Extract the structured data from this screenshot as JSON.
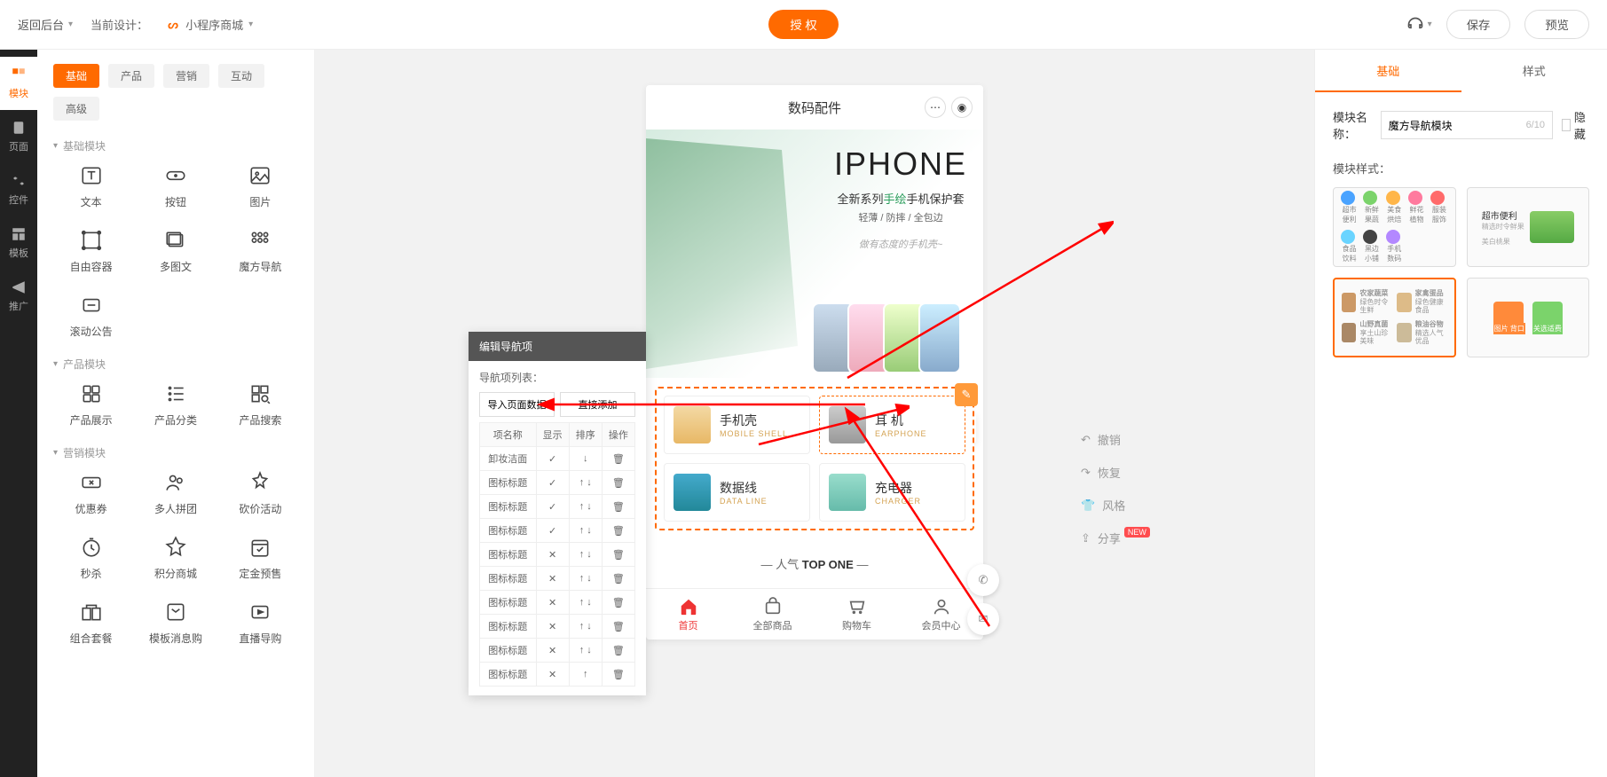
{
  "topbar": {
    "back": "返回后台",
    "cur_design_label": "当前设计：",
    "cur_design_value": "小程序商城",
    "auth": "授 权",
    "save": "保存",
    "preview": "预览"
  },
  "rail": [
    {
      "label": "模块",
      "active": true
    },
    {
      "label": "页面"
    },
    {
      "label": "控件"
    },
    {
      "label": "模板"
    },
    {
      "label": "推广"
    }
  ],
  "module_tabs_row1": [
    "基础",
    "产品",
    "营销",
    "互动"
  ],
  "module_tabs_row2": [
    "高级"
  ],
  "sections": [
    {
      "title": "基础模块",
      "items": [
        "文本",
        "按钮",
        "图片",
        "自由容器",
        "多图文",
        "魔方导航",
        "滚动公告"
      ]
    },
    {
      "title": "产品模块",
      "items": [
        "产品展示",
        "产品分类",
        "产品搜索"
      ]
    },
    {
      "title": "营销模块",
      "items": [
        "优惠券",
        "多人拼团",
        "砍价活动",
        "秒杀",
        "积分商城",
        "定金预售",
        "组合套餐",
        "模板消息购",
        "直播导购"
      ]
    }
  ],
  "navpop": {
    "title": "编辑导航项",
    "list_label": "导航项列表：",
    "import_btn": "导入页面数据",
    "add_btn": "直接添加",
    "cols": [
      "项名称",
      "显示",
      "排序",
      "操作"
    ],
    "rows": [
      {
        "name": "卸妆洁面",
        "show": true,
        "first": true
      },
      {
        "name": "图标标题",
        "show": true
      },
      {
        "name": "图标标题",
        "show": true
      },
      {
        "name": "图标标题",
        "show": true
      },
      {
        "name": "图标标题",
        "show": false
      },
      {
        "name": "图标标题",
        "show": false
      },
      {
        "name": "图标标题",
        "show": false
      },
      {
        "name": "图标标题",
        "show": false
      },
      {
        "name": "图标标题",
        "show": false
      },
      {
        "name": "图标标题",
        "show": false,
        "last": true
      }
    ]
  },
  "phone": {
    "title": "数码配件",
    "hero": {
      "h1": "IPHONE",
      "sub_pre": "全新系列",
      "sub_em": "手绘",
      "sub_post": "手机保护套",
      "sub2": "轻薄 / 防摔 / 全包边",
      "sub3": "做有态度的手机壳~"
    },
    "edit_module": "编辑模块",
    "nav": [
      {
        "cn": "手机壳",
        "en": "MOBILE SHELL"
      },
      {
        "cn": "耳 机",
        "en": "EARPHONE"
      },
      {
        "cn": "数据线",
        "en": "DATA LINE"
      },
      {
        "cn": "充电器",
        "en": "CHARGER"
      }
    ],
    "section_title_pre": "— 人气 ",
    "section_title_strong": "TOP ONE",
    "section_title_post": " —",
    "tabbar": [
      "首页",
      "全部商品",
      "购物车",
      "会员中心"
    ]
  },
  "cv_actions": {
    "undo": "撤销",
    "redo": "恢复",
    "style": "风格",
    "share": "分享",
    "new": "NEW"
  },
  "props": {
    "tab_basic": "基础",
    "tab_style": "样式",
    "name_label": "模块名称：",
    "name_value": "魔方导航模块",
    "char": "6/10",
    "hide": "隐藏",
    "style_label": "模块样式：",
    "style_a_labels": [
      "超市便利",
      "新鲜果蔬",
      "美食烘焙",
      "鲜花植物",
      "服装服饰",
      "食品饮料",
      "黑边小铺",
      "手机数码"
    ],
    "style_b": {
      "title": "超市便利",
      "sub": "精选时令鲜果",
      "more": "美白桃果"
    },
    "style_c": [
      {
        "t": "农家蔬菜",
        "s": "绿色时令生鲜"
      },
      {
        "t": "家禽蛋品",
        "s": "绿色健康食品"
      },
      {
        "t": "山野真菌",
        "s": "享土山珍美味"
      },
      {
        "t": "粮油谷物",
        "s": "精选人气优品"
      }
    ],
    "style_d": [
      "图片 背口",
      "关选适费"
    ]
  }
}
